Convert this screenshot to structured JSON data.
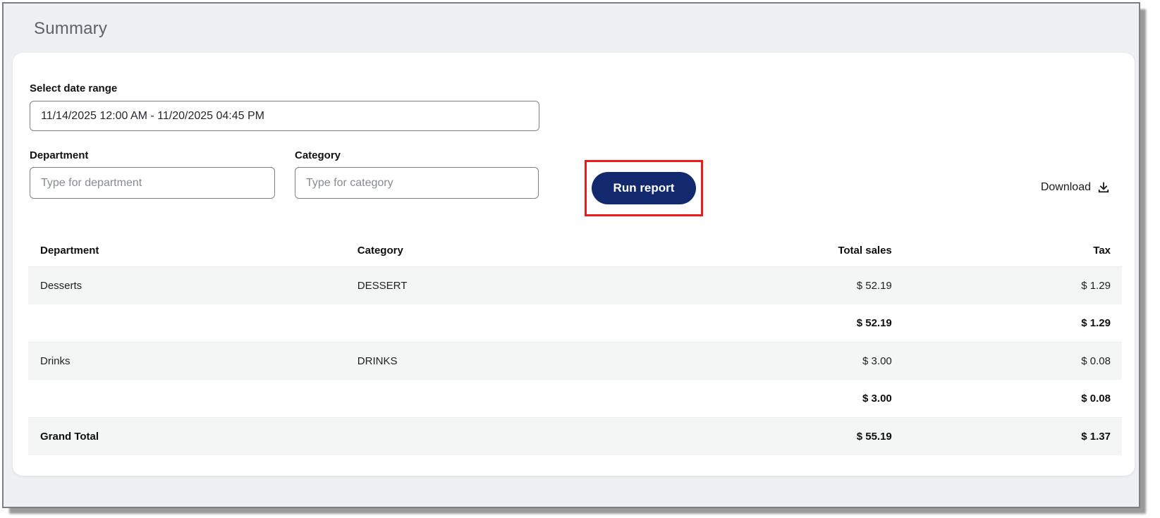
{
  "page": {
    "title": "Summary"
  },
  "filters": {
    "date_range": {
      "label": "Select date range",
      "value": "11/14/2025 12:00 AM - 11/20/2025 04:45 PM"
    },
    "department": {
      "label": "Department",
      "placeholder": "Type for department",
      "value": ""
    },
    "category": {
      "label": "Category",
      "placeholder": "Type for category",
      "value": ""
    }
  },
  "actions": {
    "run_report_label": "Run report",
    "download_label": "Download",
    "download_icon": "download-arrow-into-tray"
  },
  "annotation": {
    "type": "red-highlight-rectangle",
    "target": "run-report-button",
    "color": "#ee1b1b"
  },
  "colors": {
    "primary_button": "#13296e",
    "page_background": "#eef0f3",
    "row_stripe": "#f4f5f5",
    "title_text": "#5c636b"
  },
  "table": {
    "columns": [
      "Department",
      "Category",
      "Total sales",
      "Tax"
    ],
    "rows": [
      {
        "type": "data",
        "department": "Desserts",
        "category": "DESSERT",
        "total_sales": "$ 52.19",
        "tax": "$ 1.29"
      },
      {
        "type": "subtotal",
        "department": "",
        "category": "",
        "total_sales": "$ 52.19",
        "tax": "$ 1.29"
      },
      {
        "type": "data",
        "department": "Drinks",
        "category": "DRINKS",
        "total_sales": "$ 3.00",
        "tax": "$ 0.08"
      },
      {
        "type": "subtotal",
        "department": "",
        "category": "",
        "total_sales": "$ 3.00",
        "tax": "$ 0.08"
      },
      {
        "type": "grand_total",
        "department": "Grand Total",
        "category": "",
        "total_sales": "$ 55.19",
        "tax": "$ 1.37"
      }
    ]
  }
}
